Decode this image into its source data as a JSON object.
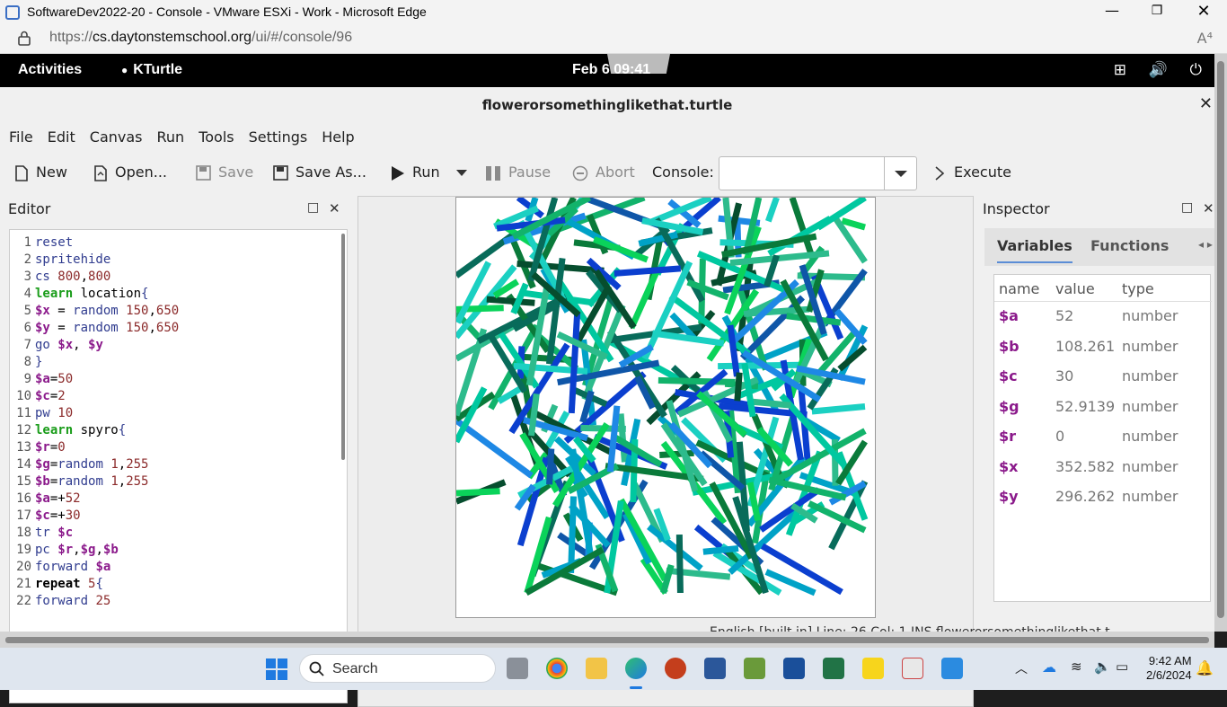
{
  "browser": {
    "window_title": "SoftwareDev2022-20 - Console - VMware ESXi - Work - Microsoft Edge",
    "url_prefix": "https://",
    "url_host": "cs.daytonstemschool.org",
    "url_path": "/ui/#/console/96",
    "minimize": "—",
    "restore": "❐",
    "close": "✕",
    "read_aloud": "A⁴"
  },
  "gnome": {
    "activities": "Activities",
    "app_name": "KTurtle",
    "clock": "Feb 6  09:41",
    "tray": "⊞ 🔊 ⏻"
  },
  "kturtle": {
    "window_title": "flowerorsomethinglikethat.turtle",
    "close": "✕",
    "menu": [
      "File",
      "Edit",
      "Canvas",
      "Run",
      "Tools",
      "Settings",
      "Help"
    ],
    "toolbar": {
      "new": "New",
      "open": "Open...",
      "save": "Save",
      "save_as": "Save As...",
      "run": "Run",
      "pause": "Pause",
      "abort": "Abort",
      "console_label": "Console:",
      "execute": "Execute"
    },
    "editor": {
      "title": "Editor",
      "float": "□",
      "close": "✕",
      "lines": [
        "1",
        "2",
        "3",
        "4",
        "5",
        "6",
        "7",
        "8",
        "9",
        "10",
        "11",
        "12",
        "13",
        "14",
        "15",
        "16",
        "17",
        "18",
        "19",
        "20",
        "21",
        "22"
      ]
    },
    "inspector": {
      "title": "Inspector",
      "float": "□",
      "close": "✕",
      "tabs": [
        "Variables",
        "Functions"
      ],
      "tab_arrows": "◂ ▸",
      "columns": [
        "name",
        "value",
        "type"
      ],
      "variables": [
        {
          "name": "$a",
          "value": "52",
          "type": "number"
        },
        {
          "name": "$b",
          "value": "108.261",
          "type": "number"
        },
        {
          "name": "$c",
          "value": "30",
          "type": "number"
        },
        {
          "name": "$g",
          "value": "52.9139",
          "type": "number"
        },
        {
          "name": "$r",
          "value": "0",
          "type": "number"
        },
        {
          "name": "$x",
          "value": "352.582",
          "type": "number"
        },
        {
          "name": "$y",
          "value": "296.262",
          "type": "number"
        }
      ]
    },
    "status": "English [built in]    Line: 26 Col: 1    INS    flowerorsomethinglikethat.t"
  },
  "taskbar": {
    "search": "Search",
    "time": "9:42 AM",
    "date": "2/6/2024"
  },
  "colors": {
    "accent": "#1f7ae0",
    "keyword": "#1b9d1b",
    "variable": "#8b1a8b",
    "command": "#303c8f"
  }
}
